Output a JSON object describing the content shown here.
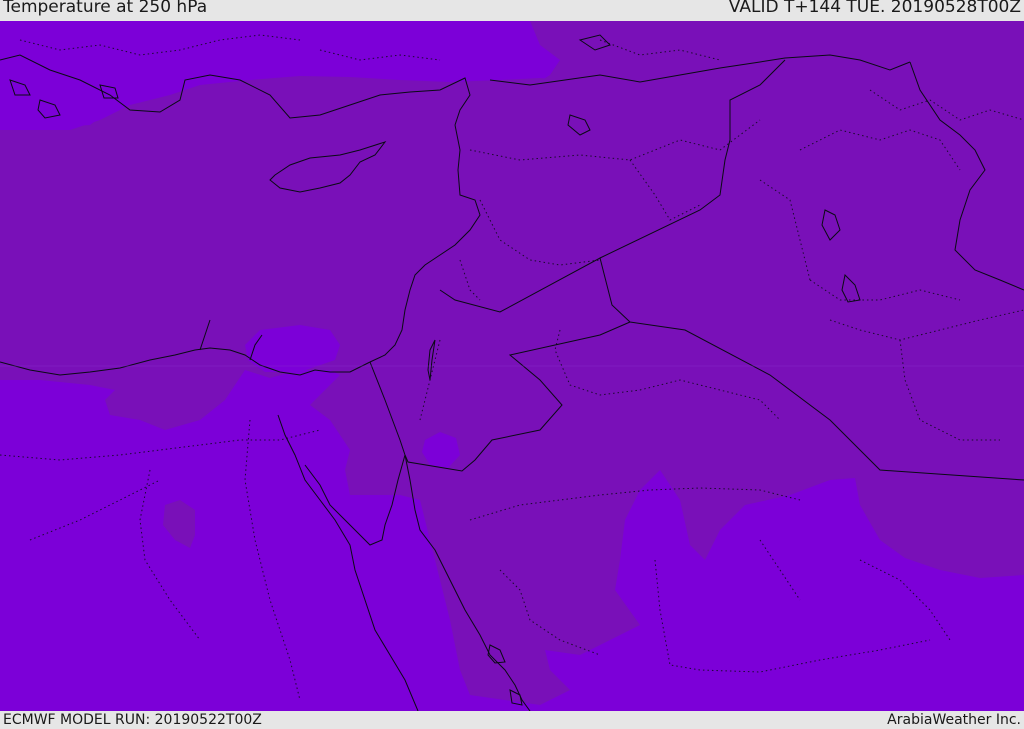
{
  "header": {
    "title": "Temperature at 250 hPa",
    "valid": "VALID T+144 TUE. 20190528T00Z"
  },
  "footer": {
    "model_run": "ECMWF MODEL RUN: 20190522T00Z",
    "credit": "ArabiaWeather Inc."
  },
  "colors": {
    "warmer_band": "#7910b8",
    "colder_band": "#7c00d8",
    "coastline": "#0a0a14",
    "bar_background": "#e6e6e6"
  }
}
